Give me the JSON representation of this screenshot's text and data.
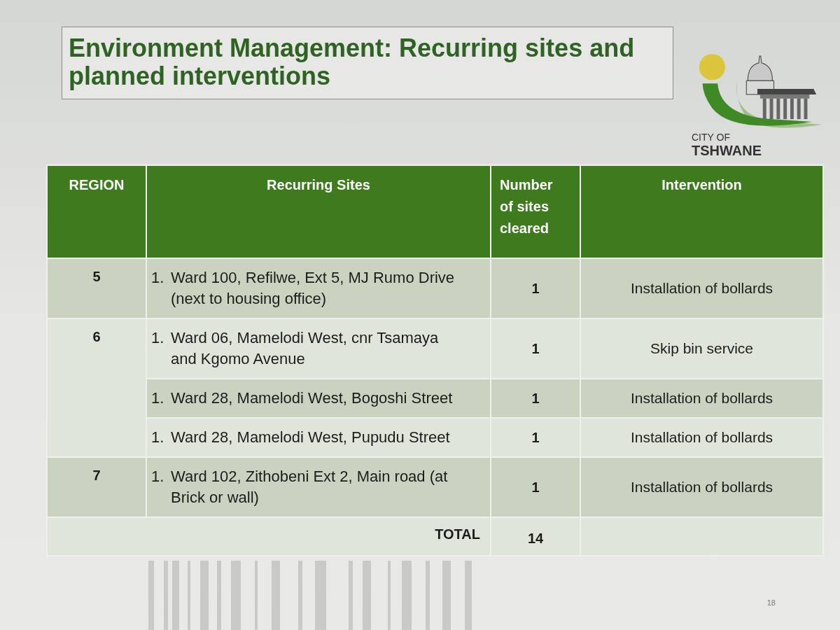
{
  "slide": {
    "title": "Environment Management: Recurring sites and planned interventions",
    "page_number": "18"
  },
  "logo": {
    "line_1": "CITY OF",
    "line_2": "TSHWANE"
  },
  "table": {
    "columns": [
      "REGION",
      "Recurring Sites",
      "Number of sites cleared",
      "Intervention"
    ],
    "regions": [
      {
        "region": "5",
        "sites": [
          {
            "number": "1.",
            "site": "Ward 100, Refilwe, Ext 5, MJ Rumo Drive (next to housing office)",
            "cleared": "1",
            "intervention": "Installation of bollards"
          }
        ]
      },
      {
        "region": "6",
        "sites": [
          {
            "number": "1.",
            "site": "Ward 06, Mamelodi West, cnr Tsamaya and Kgomo Avenue",
            "cleared": "1",
            "intervention": "Skip bin service"
          },
          {
            "number": "1.",
            "site": "Ward 28, Mamelodi West, Bogoshi Street",
            "cleared": "1",
            "intervention": "Installation of bollards"
          },
          {
            "number": "1.",
            "site": "Ward 28, Mamelodi West, Pupudu Street",
            "cleared": "1",
            "intervention": "Installation of bollards"
          }
        ]
      },
      {
        "region": "7",
        "sites": [
          {
            "number": "1.",
            "site": "Ward 102, Zithobeni Ext 2, Main road (at Brick or wall)",
            "cleared": "1",
            "intervention": "Installation of bollards"
          }
        ]
      }
    ],
    "total": {
      "label": "TOTAL",
      "value": "14"
    }
  }
}
